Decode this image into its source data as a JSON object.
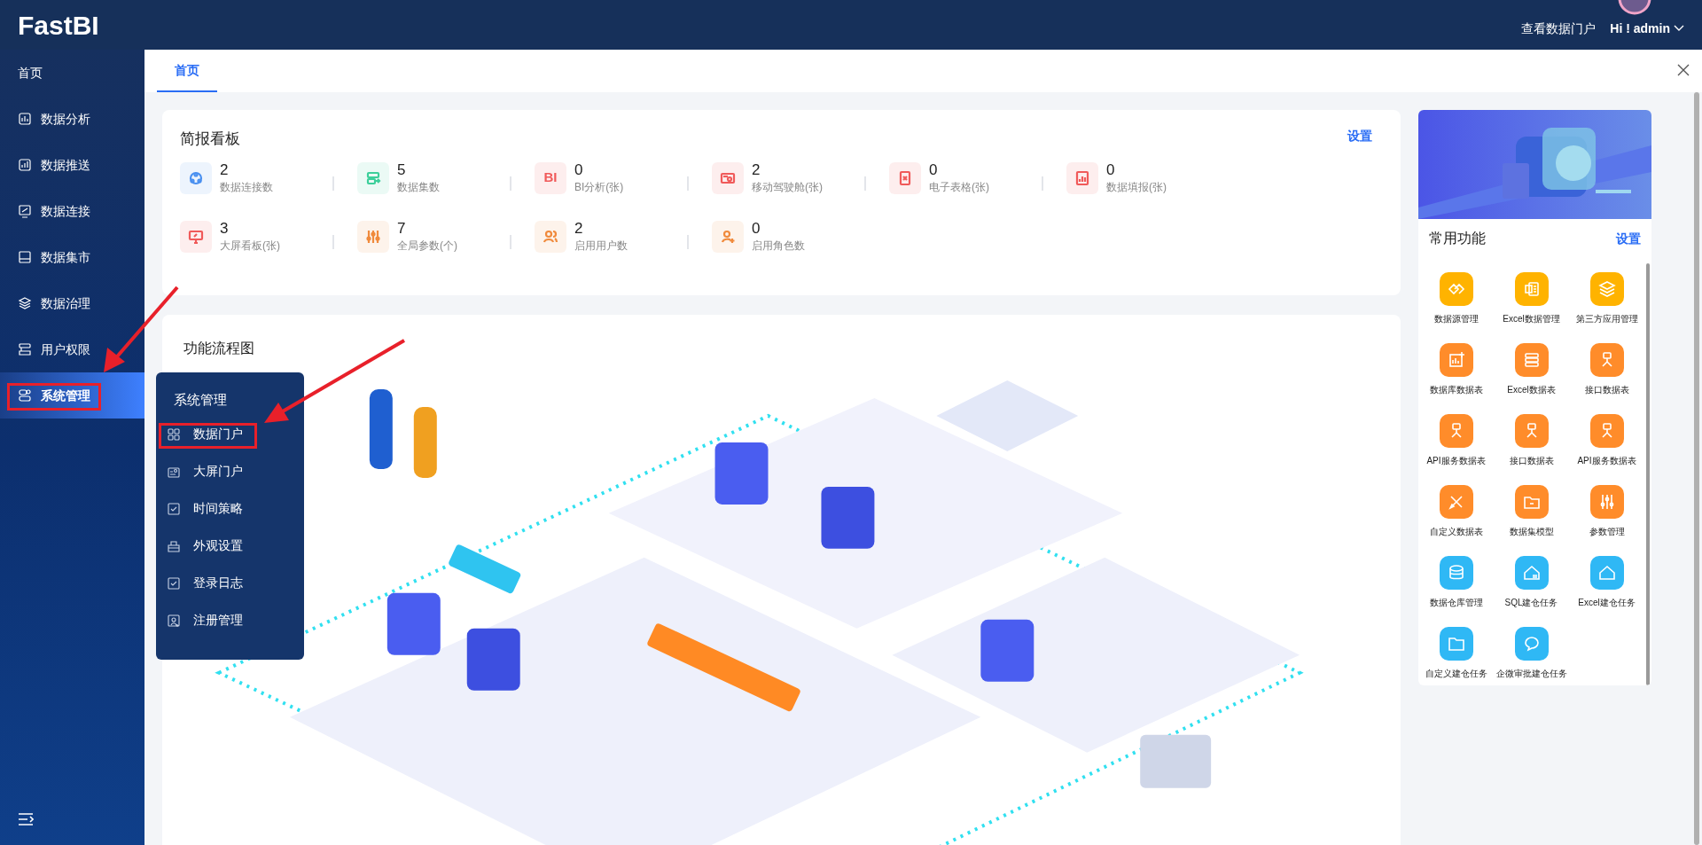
{
  "header": {
    "logo": "FastBI",
    "portal_link": "查看数据门户",
    "user": "Hi ! admin"
  },
  "sidebar": {
    "items": [
      {
        "label": "首页",
        "selected": false
      },
      {
        "label": "数据分析",
        "selected": false
      },
      {
        "label": "数据推送",
        "selected": false
      },
      {
        "label": "数据连接",
        "selected": false
      },
      {
        "label": "数据集市",
        "selected": false
      },
      {
        "label": "数据治理",
        "selected": false
      },
      {
        "label": "用户权限",
        "selected": false
      },
      {
        "label": "系统管理",
        "selected": true
      }
    ]
  },
  "submenu": {
    "title": "系统管理",
    "items": [
      "数据门户",
      "大屏门户",
      "时间策略",
      "外观设置",
      "登录日志",
      "注册管理"
    ]
  },
  "tabs": [
    {
      "label": "首页",
      "selected": true
    }
  ],
  "summary": {
    "title": "简报看板",
    "settings": "设置",
    "items": [
      {
        "value": "2",
        "label": "数据连接数",
        "color": "#4a90f0"
      },
      {
        "value": "5",
        "label": "数据集数",
        "color": "#3ccf9a"
      },
      {
        "value": "0",
        "label": "BI分析(张)",
        "color": "#f05a5a",
        "icon_text": "BI"
      },
      {
        "value": "2",
        "label": "移动驾驶舱(张)",
        "color": "#f05a5a"
      },
      {
        "value": "0",
        "label": "电子表格(张)",
        "color": "#f05a5a"
      },
      {
        "value": "0",
        "label": "数据填报(张)",
        "color": "#f05a5a"
      },
      {
        "value": "3",
        "label": "大屏看板(张)",
        "color": "#f05a5a"
      },
      {
        "value": "7",
        "label": "全局参数(个)",
        "color": "#f08a3c"
      },
      {
        "value": "2",
        "label": "启用用户数",
        "color": "#f08a3c"
      },
      {
        "value": "0",
        "label": "启用角色数",
        "color": "#f08a3c"
      }
    ]
  },
  "flow": {
    "title": "功能流程图"
  },
  "quick": {
    "title": "常用功能",
    "settings": "设置",
    "items": [
      {
        "label": "数据源管理",
        "color": "#ffb300"
      },
      {
        "label": "Excel数据管理",
        "color": "#ffb300"
      },
      {
        "label": "第三方应用管理",
        "color": "#ffb300"
      },
      {
        "label": "数据库数据表",
        "color": "#ff8c2a"
      },
      {
        "label": "Excel数据表",
        "color": "#ff8c2a"
      },
      {
        "label": "接口数据表",
        "color": "#ff8c2a"
      },
      {
        "label": "API服务数据表",
        "color": "#ff8c2a"
      },
      {
        "label": "接口数据表",
        "color": "#ff8c2a"
      },
      {
        "label": "API服务数据表",
        "color": "#ff8c2a"
      },
      {
        "label": "自定义数据表",
        "color": "#ff8c2a"
      },
      {
        "label": "数据集模型",
        "color": "#ff8c2a"
      },
      {
        "label": "参数管理",
        "color": "#ff8c2a"
      },
      {
        "label": "数据仓库管理",
        "color": "#2fb8f5"
      },
      {
        "label": "SQL建仓任务",
        "color": "#2fb8f5"
      },
      {
        "label": "Excel建仓任务",
        "color": "#2fb8f5"
      },
      {
        "label": "自定义建仓任务",
        "color": "#2fb8f5"
      },
      {
        "label": "企微审批建仓任务",
        "color": "#2fb8f5"
      }
    ]
  }
}
